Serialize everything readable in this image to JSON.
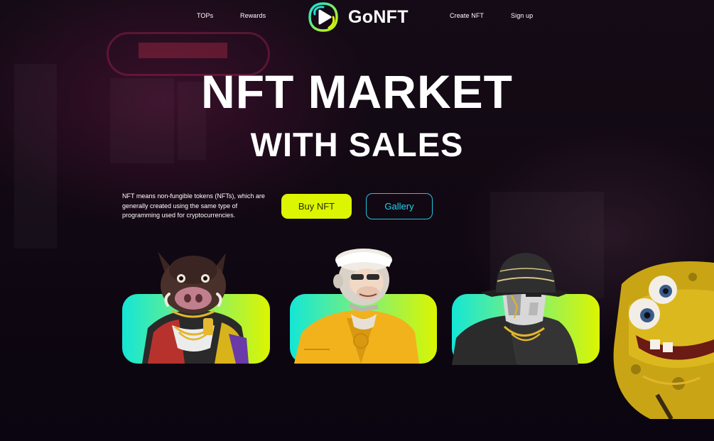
{
  "nav": {
    "left_links": [
      "TOPs",
      "Rewards"
    ],
    "right_links": [
      "Create NFT",
      "Sign up"
    ],
    "brand": "GoNFT"
  },
  "hero": {
    "title_line1": "NFT MARKET",
    "title_line2": "WITH SALES",
    "description": "NFT means non-fungible tokens (NFTs), which are generally created using the same type of programming used for cryptocurrencies.",
    "buy_label": "Buy NFT",
    "gallery_label": "Gallery"
  },
  "cards": [
    {
      "character": "boar-nft"
    },
    {
      "character": "ape-nft"
    },
    {
      "character": "robot-hat-nft"
    }
  ],
  "side_character": "sponge-nft",
  "colors": {
    "accent_lime": "#dcf500",
    "accent_cyan": "#1fc6e0",
    "card_gradient_start": "#14e6d6",
    "card_gradient_end": "#dcf500",
    "background": "#0c0610"
  },
  "icons": [
    "gonft-logo-icon"
  ]
}
